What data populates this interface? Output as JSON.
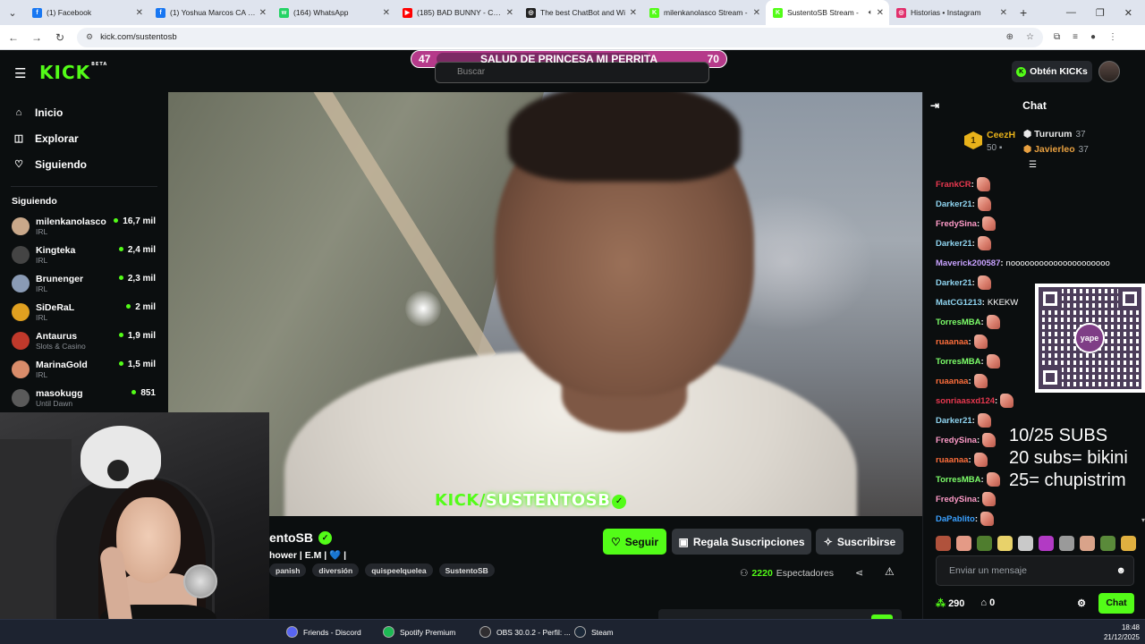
{
  "browser": {
    "tabs": [
      {
        "title": "(1) Facebook",
        "fav_color": "#1877f2",
        "fav_glyph": "f"
      },
      {
        "title": "(1) Yoshua Marcos CA | Fa",
        "fav_color": "#1877f2",
        "fav_glyph": "f"
      },
      {
        "title": "(164) WhatsApp",
        "fav_color": "#25d366",
        "fav_glyph": "w"
      },
      {
        "title": "(185) BAD BUNNY - CALL",
        "fav_color": "#ff0000",
        "fav_glyph": "▶"
      },
      {
        "title": "The best ChatBot and Wi",
        "fav_color": "#222222",
        "fav_glyph": "◎"
      },
      {
        "title": "milenkanolasco Stream -",
        "fav_color": "#53fc18",
        "fav_glyph": "K"
      },
      {
        "title": "SustentoSB Stream -",
        "fav_color": "#53fc18",
        "fav_glyph": "K",
        "active": true
      },
      {
        "title": "Historias • Instagram",
        "fav_color": "#e1306c",
        "fav_glyph": "◎"
      }
    ],
    "url": "kick.com/sustentosb"
  },
  "header": {
    "logo": "KICK",
    "logo_beta": "BETA",
    "search_placeholder": "Buscar",
    "get_kicks": "Obtén KICKs"
  },
  "banner": {
    "left_value": "47",
    "text": "SALUD DE PRINCESA MI PERRITA",
    "right_value": "70"
  },
  "sidebar": {
    "nav": [
      {
        "label": "Inicio",
        "icon": "home-icon",
        "glyph": "⌂"
      },
      {
        "label": "Explorar",
        "icon": "explore-icon",
        "glyph": "◫"
      },
      {
        "label": "Siguiendo",
        "icon": "heart-icon",
        "glyph": "♡"
      }
    ],
    "following_title": "Siguiendo",
    "following": [
      {
        "name": "milenkanolasco",
        "category": "IRL",
        "viewers": "16,7 mil",
        "avatar": "#c9a88a"
      },
      {
        "name": "Kingteka",
        "category": "IRL",
        "viewers": "2,4 mil",
        "avatar": "#444444"
      },
      {
        "name": "Brunenger",
        "category": "IRL",
        "viewers": "2,3 mil",
        "avatar": "#8a9bb5"
      },
      {
        "name": "SiDeRaL",
        "category": "IRL",
        "viewers": "2 mil",
        "avatar": "#e0a020"
      },
      {
        "name": "Antaurus",
        "category": "Slots & Casino",
        "viewers": "1,9 mil",
        "avatar": "#c0392b"
      },
      {
        "name": "MarinaGold",
        "category": "IRL",
        "viewers": "1,5 mil",
        "avatar": "#d98c6a"
      },
      {
        "name": "masokugg",
        "category": "Until Dawn",
        "viewers": "851",
        "avatar": "#5a5a5a"
      }
    ]
  },
  "video": {
    "watermark_kick": "KICK",
    "watermark_slash": "/",
    "watermark_name": "SUSTENTOSB"
  },
  "channel": {
    "name": "entoSB",
    "stream_title_a": "hower |  E.M  |",
    "stream_title_heart": "💙",
    "stream_title_b": "|",
    "tags": [
      "panish",
      "diversión",
      "quispeelquelea",
      "SustentoSB"
    ],
    "follow_label": "Seguir",
    "gift_label": "Regala Suscripciones",
    "subscribe_label": "Suscribirse",
    "viewer_count": "2220",
    "viewer_label": "Espectadores"
  },
  "chat": {
    "title": "Chat",
    "leaderboard": {
      "first_name": "CeezH",
      "first_count": "50",
      "second_name": "Tururum",
      "second_count": "37",
      "third_name": "Javierleo",
      "third_count": "37"
    },
    "messages": [
      {
        "user": "FrankCR",
        "color": "#e8384f",
        "text": "",
        "emote": true
      },
      {
        "user": "Darker21",
        "color": "#8fd4f0",
        "text": "",
        "emote": true
      },
      {
        "user": "FredySina",
        "color": "#ff9bc8",
        "text": "",
        "emote": true
      },
      {
        "user": "Darker21",
        "color": "#8fd4f0",
        "text": "",
        "emote": true
      },
      {
        "user": "Maverick200587",
        "color": "#c8a2ff",
        "text": "nooooooooooooooooooooo",
        "emote": false
      },
      {
        "user": "Darker21",
        "color": "#8fd4f0",
        "text": "",
        "emote": true
      },
      {
        "user": "MatCG1213",
        "color": "#8fd4f0",
        "text": "KKEKW",
        "emote": false
      },
      {
        "user": "TorresMBA",
        "color": "#7dff6a",
        "text": "",
        "emote": true
      },
      {
        "user": "ruaanaa",
        "color": "#ff6f3c",
        "text": "",
        "emote": true
      },
      {
        "user": "TorresMBA",
        "color": "#7dff6a",
        "text": "",
        "emote": true
      },
      {
        "user": "ruaanaa",
        "color": "#ff6f3c",
        "text": "",
        "emote": true
      },
      {
        "user": "sonriaasxd124",
        "color": "#e8384f",
        "text": "",
        "emote": true
      },
      {
        "user": "Darker21",
        "color": "#8fd4f0",
        "text": "",
        "emote": true
      },
      {
        "user": "FredySina",
        "color": "#ff9bc8",
        "text": "",
        "emote": true
      },
      {
        "user": "ruaanaa",
        "color": "#ff6f3c",
        "text": "",
        "emote": true
      },
      {
        "user": "TorresMBA",
        "color": "#7dff6a",
        "text": "",
        "emote": true
      },
      {
        "user": "FredySina",
        "color": "#ff9bc8",
        "text": "",
        "emote": true
      },
      {
        "user": "DaPablito",
        "color": "#3aa0ff",
        "text": "",
        "emote": true
      }
    ],
    "qr_label": "yape",
    "overlay_lines": [
      "10/25 SUBS",
      "20 subs= bikini",
      "25= chupistrim"
    ],
    "input_placeholder": "Enviar un mensaje",
    "points": "290",
    "gift_count": "0",
    "send_label": "Chat"
  },
  "taskbar": {
    "items": [
      {
        "label": "Friends - Discord",
        "color": "#5865f2"
      },
      {
        "label": "Spotify Premium",
        "color": "#1db954"
      },
      {
        "label": "OBS 30.0.2 - Perfil: ...",
        "color": "#302e31"
      },
      {
        "label": "Steam",
        "color": "#1b2838"
      }
    ],
    "time": "18:48",
    "date": "21/12/2025"
  }
}
